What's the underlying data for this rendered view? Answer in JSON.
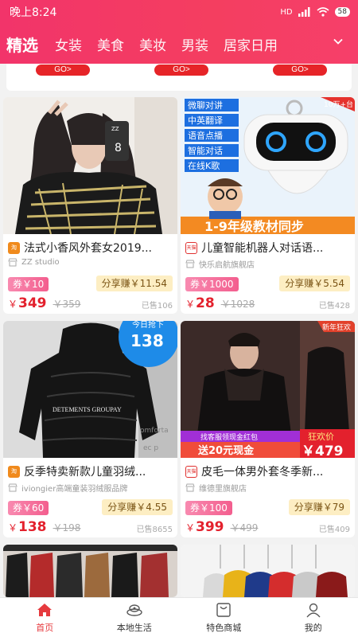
{
  "status_bar": {
    "time": "晚上8:24",
    "signal": "HD",
    "battery": "58"
  },
  "tabs": [
    {
      "label": "精选",
      "active": true
    },
    {
      "label": "女装"
    },
    {
      "label": "美食"
    },
    {
      "label": "美妆"
    },
    {
      "label": "男装"
    },
    {
      "label": "居家日用"
    }
  ],
  "go_buttons": [
    "GO>",
    "GO>",
    "GO>"
  ],
  "products": [
    {
      "title": "法式小香风外套女2019...",
      "shop": "ZZ studio",
      "coupon": "券￥10",
      "share": "分享赚￥11.54",
      "price_symbol": "￥",
      "price": "349",
      "original": "￥359",
      "sold": "已售106",
      "shop_badge": "taobao",
      "image_texts": [
        "ZZ",
        "8"
      ]
    },
    {
      "title": "儿童智能机器人对话语...",
      "shop": "快乐启航旗舰店",
      "coupon": "券￥1000",
      "share": "分享赚￥5.54",
      "price_symbol": "￥",
      "price": "28",
      "original": "￥1028",
      "sold": "已售428",
      "shop_badge": "tmall",
      "image_texts": [
        "微聊对讲",
        "中英翻译",
        "语音点播",
        "智能对话",
        "在线K歌",
        "1-9年级教材同步",
        "10万+台"
      ]
    },
    {
      "title": "反季特卖新款儿童羽绒...",
      "shop": "iviongier高端童装羽绒服品牌",
      "coupon": "券￥60",
      "share": "分享赚￥4.55",
      "price_symbol": "￥",
      "price": "138",
      "original": "￥198",
      "sold": "已售8655",
      "shop_badge": "taobao",
      "image_texts": [
        "今日抢下",
        "138",
        "DETEMENTS GROUPAY",
        "omforta",
        "ec p"
      ]
    },
    {
      "title": "皮毛一体男外套冬季新...",
      "shop": "维德里旗舰店",
      "coupon": "券￥100",
      "share": "分享赚￥79",
      "price_symbol": "￥",
      "price": "399",
      "original": "￥499",
      "sold": "已售409",
      "shop_badge": "tmall",
      "image_texts": [
        "新年狂欢",
        "找客服领现金红包",
        "送20元现金",
        "狂欢价",
        "￥479"
      ]
    }
  ],
  "bottom_nav": [
    {
      "label": "首页",
      "icon": "home-icon",
      "active": true
    },
    {
      "label": "本地生活",
      "icon": "local-life-icon"
    },
    {
      "label": "特色商城",
      "icon": "bag-icon"
    },
    {
      "label": "我的",
      "icon": "user-icon"
    }
  ],
  "colors": {
    "brand": "#f2346a",
    "price": "#e3212d",
    "active_nav": "#e63a3e"
  }
}
